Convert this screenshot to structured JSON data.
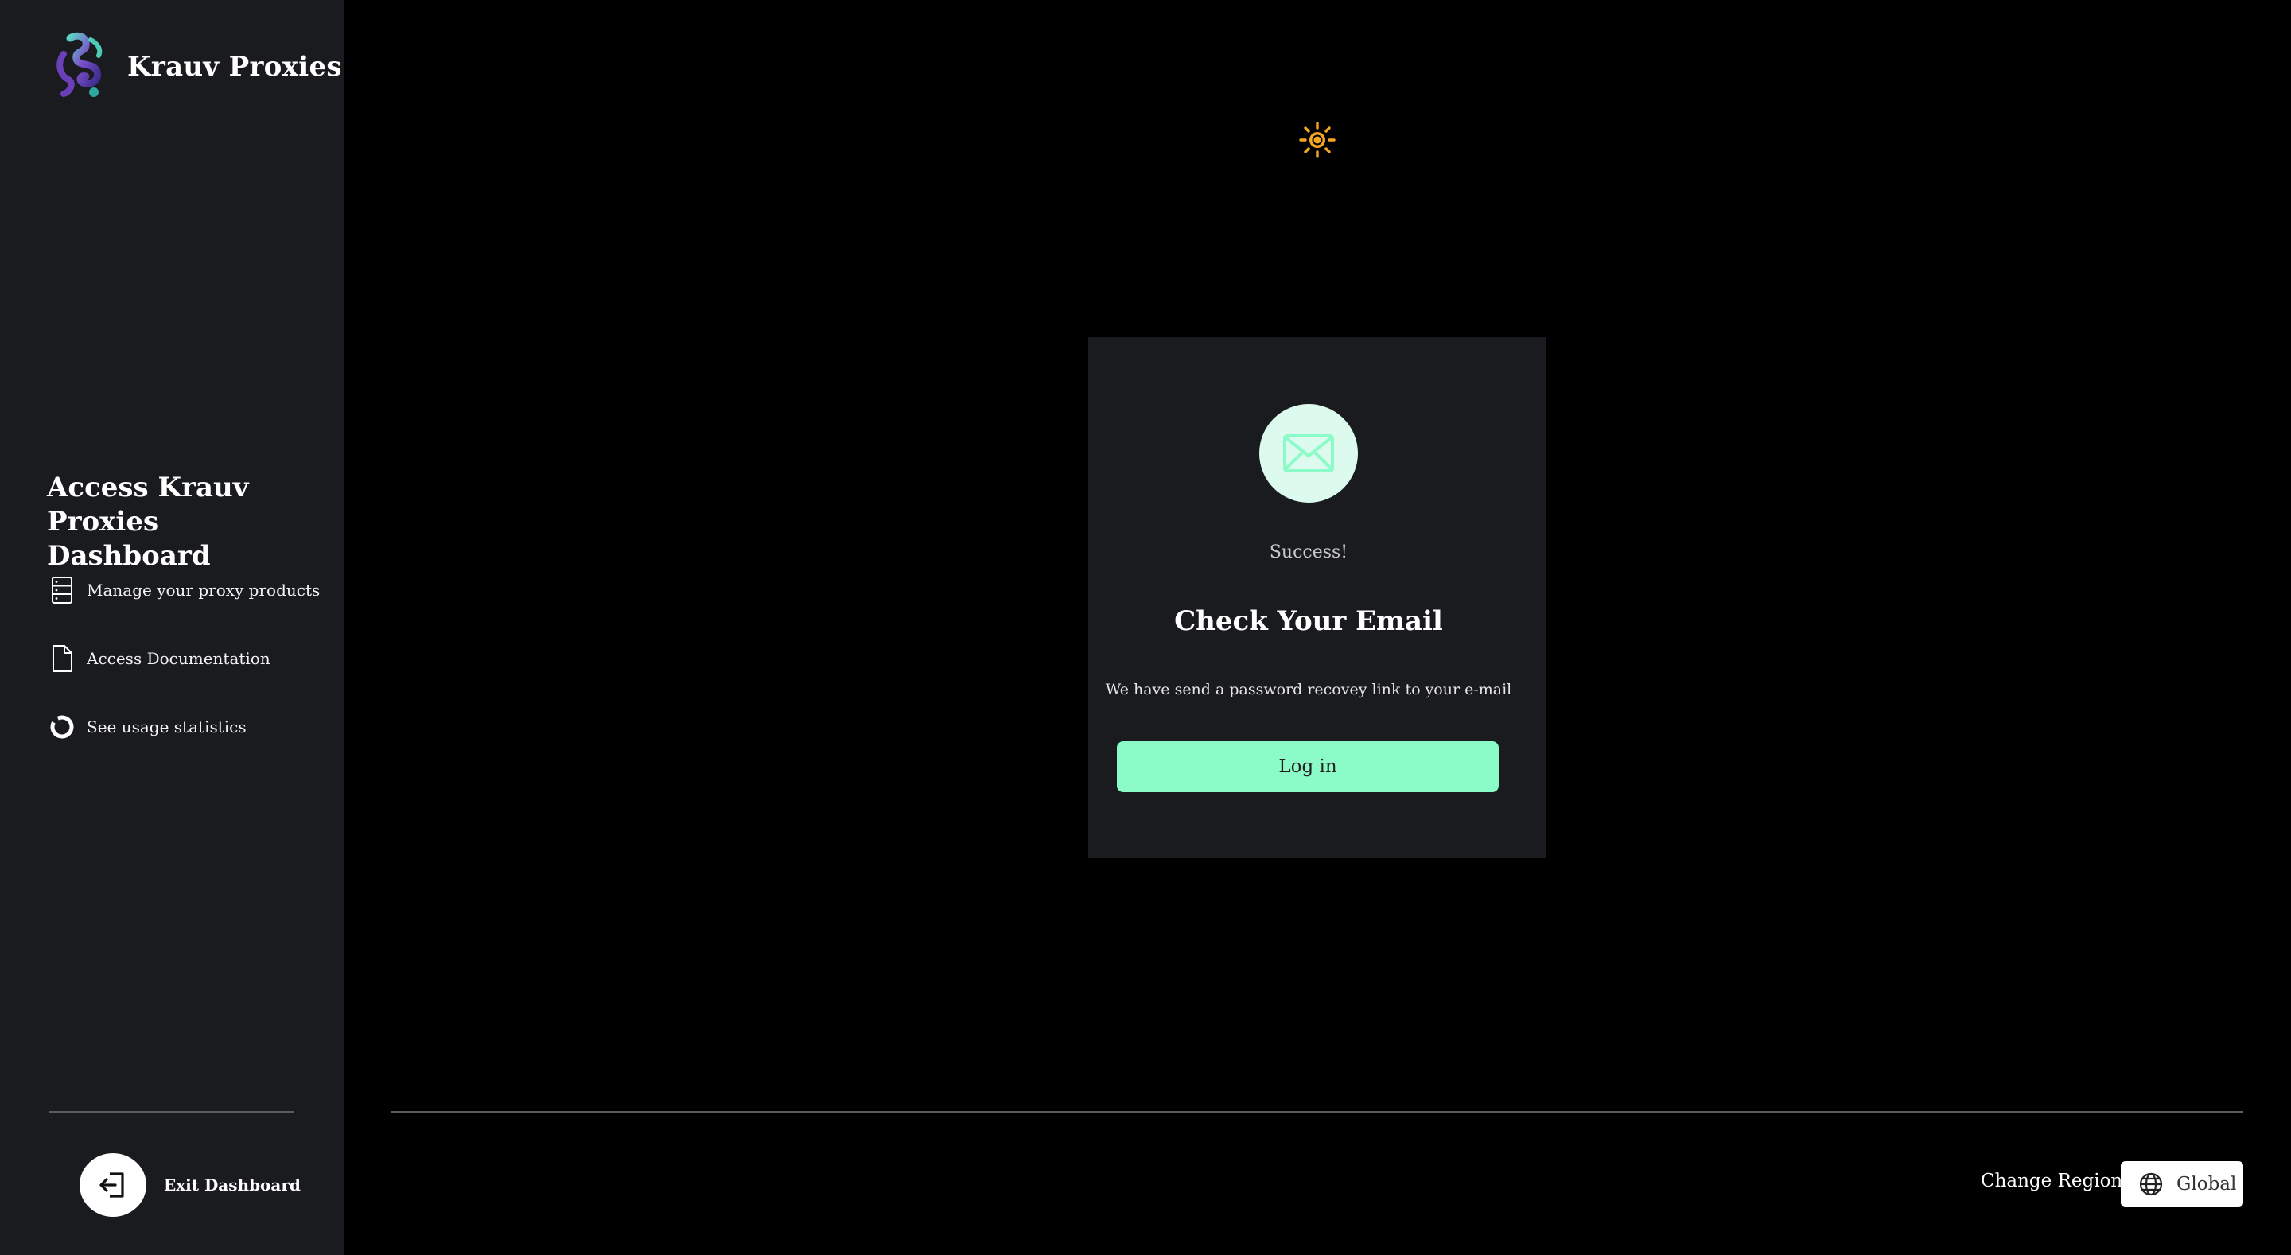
{
  "brand": {
    "name": "Krauv Proxies"
  },
  "sidebar": {
    "promo_title": "Access Krauv Proxies Dashboard",
    "features": [
      {
        "label": "Manage your proxy products",
        "icon": "server-list-icon"
      },
      {
        "label": "Access Documentation",
        "icon": "document-icon"
      },
      {
        "label": "See usage statistics",
        "icon": "donut-chart-icon"
      }
    ],
    "exit_label": "Exit Dashboard"
  },
  "card": {
    "status": "Success!",
    "title": "Check Your Email",
    "description": "We have send a password recovey link to your e-mail",
    "button_label": "Log in"
  },
  "footer": {
    "region_label": "Change Region",
    "region_value": "Global"
  },
  "colors": {
    "accent": "#8bfcc8",
    "sidebar_bg": "#1a1b1e",
    "page_bg": "#000000",
    "sun": "#f5a623"
  }
}
